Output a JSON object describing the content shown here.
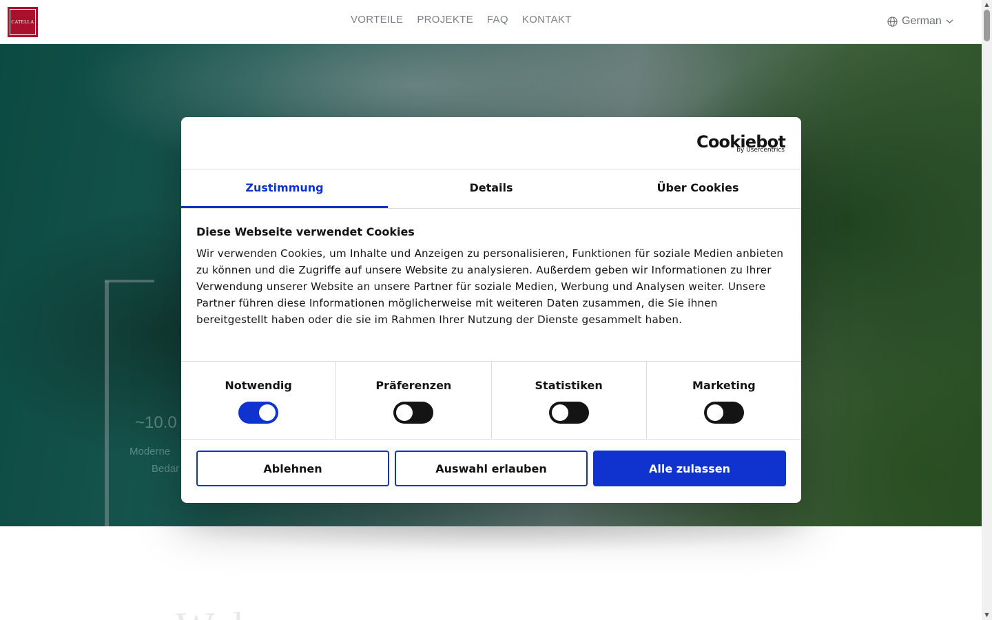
{
  "header": {
    "logo_text": "CATELLA",
    "nav": [
      "VORTEILE",
      "PROJEKTE",
      "FAQ",
      "KONTAKT"
    ],
    "language": "German",
    "icons": {
      "language": "globe-icon",
      "dropdown": "chevron-down-icon"
    }
  },
  "hero": {
    "number_fragment": "~10.0",
    "line1_fragment": "Moderne",
    "line2_fragment": "Bedar"
  },
  "welcome_fragment": "Wel",
  "cookie_dialog": {
    "brand": "Cookiebot",
    "brand_sub": "by Usercentrics",
    "tabs": [
      "Zustimmung",
      "Details",
      "Über Cookies"
    ],
    "active_tab": "Zustimmung",
    "heading": "Diese Webseite verwendet Cookies",
    "text": "Wir verwenden Cookies, um Inhalte und Anzeigen zu personalisieren, Funktionen für soziale Medien anbieten zu können und die Zugriffe auf unsere Website zu analysieren. Außerdem geben wir Informationen zu Ihrer Verwendung unserer Website an unsere Partner für soziale Medien, Werbung und Analysen weiter. Unsere Partner führen diese Informationen möglicherweise mit weiteren Daten zusammen, die Sie ihnen bereitgestellt haben oder die sie im Rahmen Ihrer Nutzung der Dienste gesammelt haben.",
    "categories": [
      {
        "label": "Notwendig",
        "enabled": true
      },
      {
        "label": "Präferenzen",
        "enabled": false
      },
      {
        "label": "Statistiken",
        "enabled": false
      },
      {
        "label": "Marketing",
        "enabled": false
      }
    ],
    "buttons": {
      "decline": "Ablehnen",
      "allow_selection": "Auswahl erlauben",
      "allow_all": "Alle zulassen"
    },
    "accent_color": "#1032cf"
  }
}
